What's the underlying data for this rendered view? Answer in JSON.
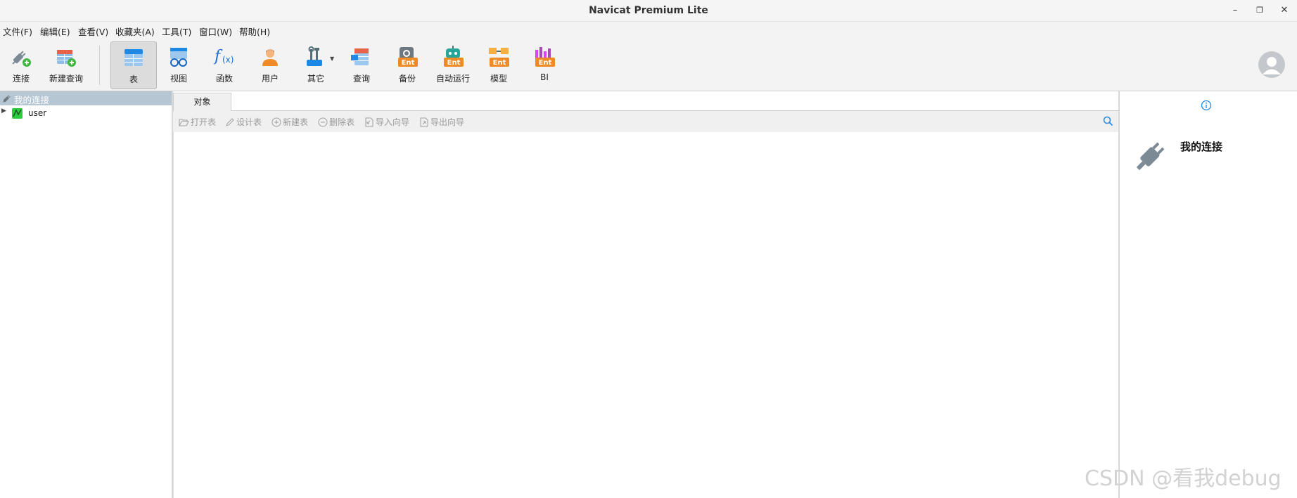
{
  "window": {
    "title": "Navicat Premium Lite",
    "minimize_icon": "minimize-icon",
    "restore_icon": "restore-icon",
    "close_icon": "close-icon"
  },
  "menu": [
    {
      "label": "文件(F)"
    },
    {
      "label": "编辑(E)"
    },
    {
      "label": "查看(V)"
    },
    {
      "label": "收藏夹(A)"
    },
    {
      "label": "工具(T)"
    },
    {
      "label": "窗口(W)"
    },
    {
      "label": "帮助(H)"
    }
  ],
  "toolbar": {
    "items": [
      {
        "label": "连接",
        "icon": "connection-plug-icon"
      },
      {
        "label": "新建查询",
        "icon": "new-query-icon"
      },
      {
        "label": "表",
        "icon": "table-icon"
      },
      {
        "label": "视图",
        "icon": "view-glasses-icon"
      },
      {
        "label": "函数",
        "icon": "function-fx-icon"
      },
      {
        "label": "用户",
        "icon": "user-icon"
      },
      {
        "label": "其它",
        "icon": "tools-icon"
      },
      {
        "label": "查询",
        "icon": "query-icon"
      },
      {
        "label": "备份",
        "icon": "backup-ent-icon"
      },
      {
        "label": "自动运行",
        "icon": "automation-robot-ent-icon"
      },
      {
        "label": "模型",
        "icon": "model-ent-icon"
      },
      {
        "label": "BI",
        "icon": "bi-chart-ent-icon"
      }
    ],
    "ent_badge": "Ent",
    "active": "表"
  },
  "navigator": {
    "header": "我的连接",
    "items": [
      {
        "label": "user"
      }
    ]
  },
  "objects": {
    "tab": "对象",
    "actions": [
      {
        "label": "打开表",
        "icon": "folder-open-icon"
      },
      {
        "label": "设计表",
        "icon": "pencil-icon"
      },
      {
        "label": "新建表",
        "icon": "plus-circle-icon"
      },
      {
        "label": "删除表",
        "icon": "minus-circle-icon"
      },
      {
        "label": "导入向导",
        "icon": "import-icon"
      },
      {
        "label": "导出向导",
        "icon": "export-icon"
      }
    ]
  },
  "info_panel": {
    "title": "我的连接"
  },
  "watermark": "CSDN @看我debug",
  "colors": {
    "accent_blue": "#1e88e5",
    "nav_header": "#b7c6d3",
    "ent_orange": "#f08a24"
  }
}
